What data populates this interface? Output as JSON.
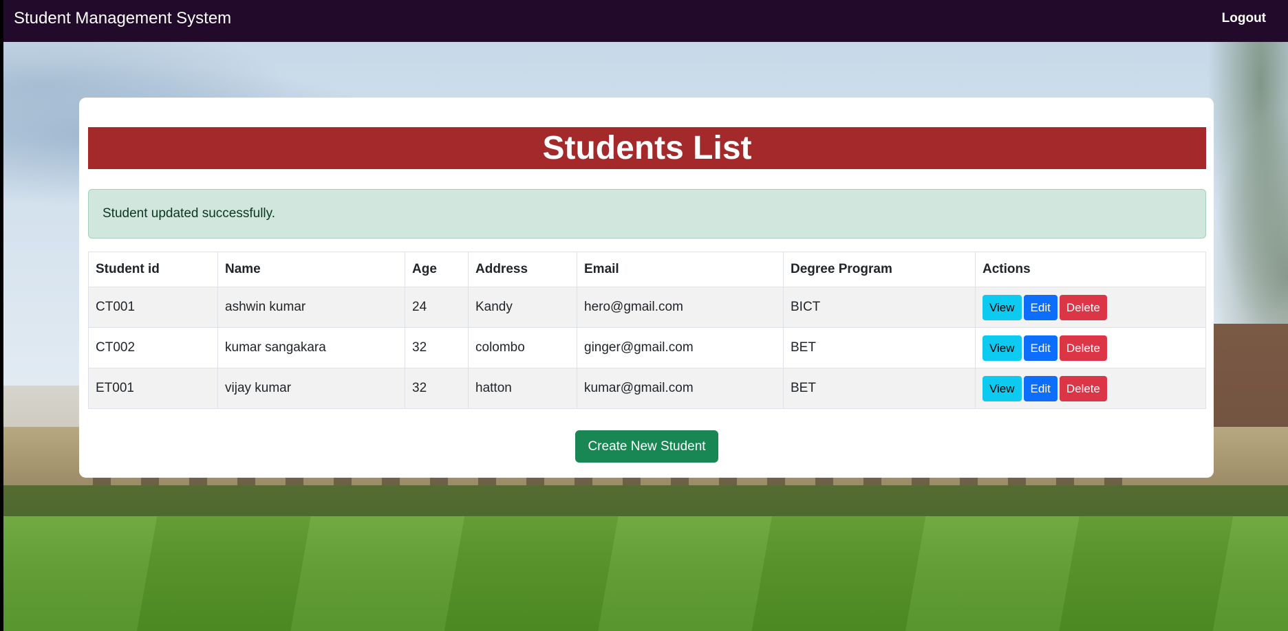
{
  "navbar": {
    "brand": "Student Management System",
    "logout_label": "Logout"
  },
  "main": {
    "title": "Students List",
    "alert": "Student updated successfully.",
    "create_button_label": "Create New Student"
  },
  "table": {
    "headers": [
      "Student id",
      "Name",
      "Age",
      "Address",
      "Email",
      "Degree Program",
      "Actions"
    ],
    "rows": [
      {
        "id": "CT001",
        "name": "ashwin kumar",
        "age": "24",
        "address": "Kandy",
        "email": "hero@gmail.com",
        "degree": "BICT"
      },
      {
        "id": "CT002",
        "name": "kumar sangakara",
        "age": "32",
        "address": "colombo",
        "email": "ginger@gmail.com",
        "degree": "BET"
      },
      {
        "id": "ET001",
        "name": "vijay kumar",
        "age": "32",
        "address": "hatton",
        "email": "kumar@gmail.com",
        "degree": "BET"
      }
    ],
    "actions": {
      "view": "View",
      "edit": "Edit",
      "delete": "Delete"
    }
  },
  "colors": {
    "navbar_bg": "#220b2a",
    "title_bar_bg": "#a3292b",
    "alert_bg": "#d1e7dd",
    "view_button": "#0dcaf0",
    "edit_button": "#0d6efd",
    "delete_button": "#dc3545",
    "create_button": "#198754"
  }
}
